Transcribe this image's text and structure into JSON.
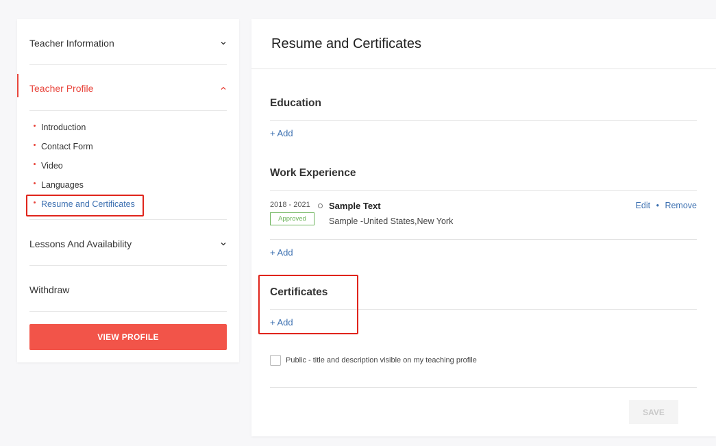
{
  "sidebar": {
    "sections": [
      {
        "label": "Teacher Information",
        "expanded": false,
        "icon": "chevron-down-icon"
      },
      {
        "label": "Teacher Profile",
        "expanded": true,
        "icon": "chevron-up-icon"
      },
      {
        "label": "Lessons And Availability",
        "expanded": false,
        "icon": "chevron-down-icon"
      },
      {
        "label": "Withdraw"
      }
    ],
    "profile_items": [
      {
        "label": "Introduction"
      },
      {
        "label": "Contact Form"
      },
      {
        "label": "Video"
      },
      {
        "label": "Languages"
      },
      {
        "label": "Resume and Certificates",
        "active": true
      }
    ],
    "view_profile_label": "VIEW PROFILE"
  },
  "main": {
    "title": "Resume and Certificates",
    "education": {
      "heading": "Education",
      "add_label": "+ Add"
    },
    "work_experience": {
      "heading": "Work Experience",
      "entries": [
        {
          "years": "2018 - 2021",
          "status": "Approved",
          "title": "Sample Text",
          "subtitle": "Sample -United States,New York",
          "edit_label": "Edit",
          "separator": "•",
          "remove_label": "Remove"
        }
      ],
      "add_label": "+ Add"
    },
    "certificates": {
      "heading": "Certificates",
      "add_label": "+ Add"
    },
    "public_checkbox": {
      "label": "Public - title and description visible on my teaching profile",
      "checked": false
    },
    "save_label": "SAVE"
  },
  "colors": {
    "accent_red": "#e8453c",
    "button_red": "#f25449",
    "link_blue": "#3b6fb0",
    "approved_green": "#6bb35a",
    "highlight_red": "#e0241b"
  }
}
